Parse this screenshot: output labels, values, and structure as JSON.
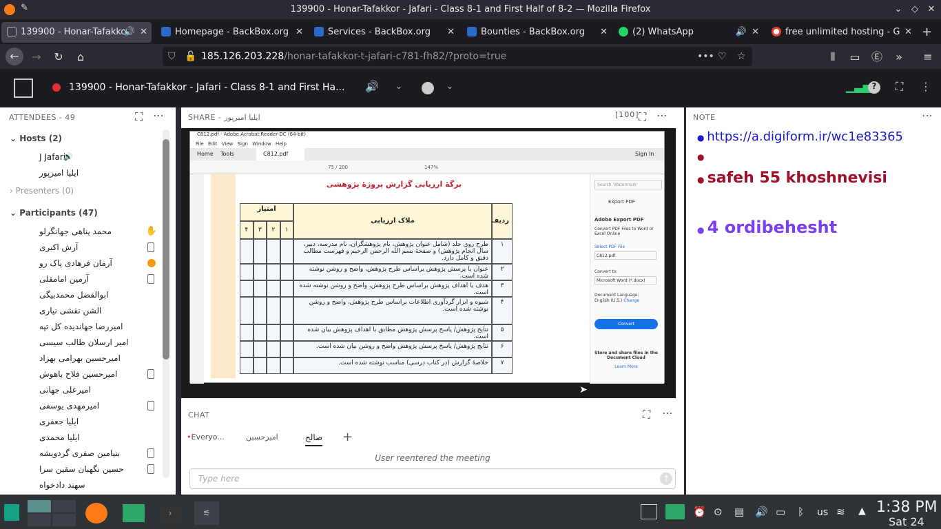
{
  "window": {
    "title": "139900 - Honar-Tafakkor - Jafari - Class 8-1 and First Half of 8-2 — Mozilla Firefox"
  },
  "tabs": [
    {
      "label": "139900 - Honar-Tafakko",
      "color": "#e44"
    },
    {
      "label": "Homepage - BackBox.org",
      "color": "#2a6ac9"
    },
    {
      "label": "Services - BackBox.org",
      "color": "#2a6ac9"
    },
    {
      "label": "Bounties - BackBox.org",
      "color": "#2a6ac9"
    },
    {
      "label": "(2) WhatsApp",
      "color": "#25d366"
    },
    {
      "label": "free unlimited hosting - G",
      "color": "#ea4335"
    }
  ],
  "url": {
    "host": "185.126.203.228",
    "path": "/honar-tafakkor-t-jafari-c781-fh82/?proto=true"
  },
  "meeting": {
    "title": "139900 - Honar-Tafakkor - Jafari - Class 8-1 and First Ha..."
  },
  "attendees": {
    "header": "ATTENDEES - 49",
    "hosts_label": "Hosts (2)",
    "hosts": [
      "J Jafari",
      "ایلیا امیرپور"
    ],
    "presenters_label": "Presenters (0)",
    "participants_label": "Participants (47)",
    "participants": [
      "محمد پناهی جهانگرلو",
      "آرش اکبری",
      "آرمان فرهادی پاک رو",
      "آرمین امامقلی",
      "ابوالفضل محمدبیگی",
      "الشن نقشی نیاری",
      "امیررضا جهاندیده کل تپه",
      "امیر ارسلان طالب سیسی",
      "امیرحسین بهرامی بهزاد",
      "امیرحسین فلاح باهوش",
      "امیرعلی جهانی",
      "امیرمهدی یوسفی",
      "ایلیا جعفری",
      "ایلیا محمدی",
      "بنیامین صفری گردویشه",
      "حسین نگهبان سقین سرا",
      "سهند دادخواه"
    ]
  },
  "share": {
    "header": "SHARE - ایلیا امیرپور",
    "pdf_title": "C812.pdf - Adobe Acrobat Reader DC (64-bit)",
    "menu": [
      "File",
      "Edit",
      "View",
      "Sign",
      "Window",
      "Help"
    ],
    "tabs": [
      "Home",
      "Tools",
      "C812.pdf"
    ],
    "sign_in": "Sign In",
    "page": "75 / 200",
    "zoom": "147%",
    "doc_title": "برگهٔ ارزیابی گزارش پروژهٔ پژوهشی",
    "col_radif": "ردیف",
    "col_criteria": "ملاک ارزیابی",
    "col_score": "امتیاز",
    "score_nums": [
      "۱",
      "۲",
      "۳",
      "۴"
    ],
    "rows": [
      {
        "n": "۱",
        "t": "طرح روی جلد (شامل عنوان پژوهش، نام پژوهشگران، نام مدرسه، دبیر، سال انجام پژوهش) و صفحهٔ بسم الله الرحمن الرحیم و فهرست مطالب دقیق و کامل دارد."
      },
      {
        "n": "۲",
        "t": "عنوان یا پرسش پژوهش براساس طرح پژوهش، واضح و روشن نوشته شده است."
      },
      {
        "n": "۳",
        "t": "هدف یا اهداف پژوهش براساس طرح پژوهش، واضح و روشن نوشته شده است."
      },
      {
        "n": "۴",
        "t": "شیوه و ابزار گردآوری اطلاعات براساس طرح پژوهش، واضح و روشن نوشته شده است."
      },
      {
        "n": "۵",
        "t": "نتایج پژوهش/ پاسخ پرسش پژوهش مطابق با اهداف پژوهش بیان شده است."
      },
      {
        "n": "۶",
        "t": "نتایج پژوهش/ پاسخ پرسش پژوهش واضح و روشن بیان شده است."
      },
      {
        "n": "۷",
        "t": "خلاصهٔ گزارش (در کتاب درسی) مناسب نوشته شده است."
      }
    ],
    "side": {
      "search": "Search 'Watermark'",
      "export": "Export PDF",
      "adobe": "Adobe Export PDF",
      "desc": "Convert PDF Files to Word or Excel Online",
      "select": "Select PDF File",
      "file": "C812.pdf",
      "convert_to": "Convert to",
      "format": "Microsoft Word (*.docx)",
      "lang_label": "Document Language:",
      "lang": "English (U.S.)",
      "change": "Change",
      "convert": "Convert",
      "store": "Store and share files in the Document Cloud",
      "learn": "Learn More"
    }
  },
  "chat": {
    "header": "CHAT",
    "tabs": [
      "Everyo...",
      "امیرحسین",
      "صالح"
    ],
    "message": "User reentered the meeting",
    "placeholder": "Type here"
  },
  "note": {
    "header": "NOTE",
    "items": [
      {
        "text": "https://a.digiform.ir/wc1e83365",
        "color": "#1a1ac8",
        "size": 18
      },
      {
        "text": "",
        "color": "#a0102a",
        "size": 18
      },
      {
        "text": "safeh 55 khoshnevisi",
        "color": "#a0102a",
        "size": 22
      },
      {
        "text": "4 ordibehesht",
        "color": "#7b3ff2",
        "size": 24
      }
    ]
  },
  "taskbar": {
    "kb": "us",
    "time": "1:38 PM",
    "date": "Sat 24"
  }
}
